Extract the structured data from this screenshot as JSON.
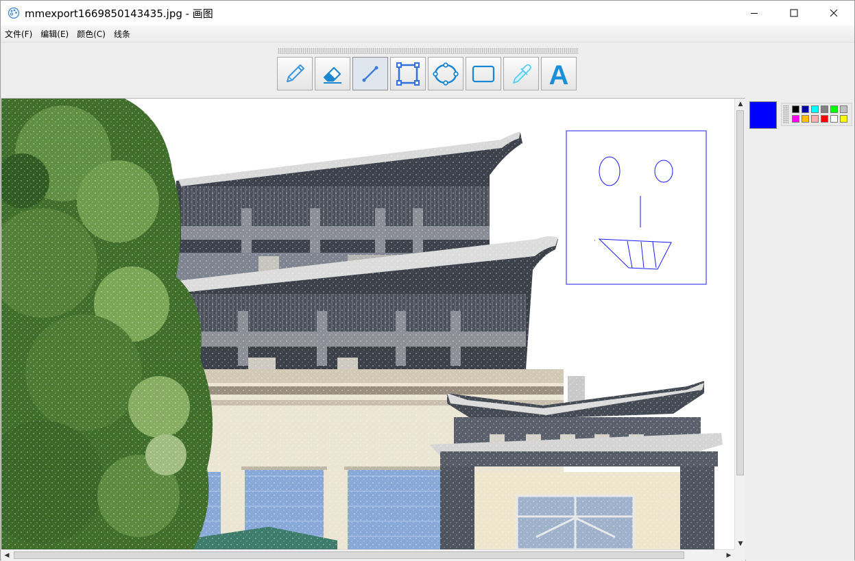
{
  "window": {
    "title": "mmexport1669850143435.jpg - 画图",
    "controls": {
      "minimize_icon": "minimize-icon",
      "maximize_icon": "maximize-icon",
      "close_icon": "close-icon"
    }
  },
  "menu": {
    "items": [
      {
        "label": "文件(F)"
      },
      {
        "label": "编辑(E)"
      },
      {
        "label": "颜色(C)"
      },
      {
        "label": "线条"
      }
    ]
  },
  "toolbar": {
    "tools": [
      {
        "icon": "pencil-icon",
        "selected": false
      },
      {
        "icon": "eraser-icon",
        "selected": false
      },
      {
        "icon": "line-icon",
        "selected": true
      },
      {
        "icon": "rectangle-select-icon",
        "selected": false
      },
      {
        "icon": "ellipse-icon",
        "selected": false
      },
      {
        "icon": "rounded-rectangle-icon",
        "selected": false
      },
      {
        "icon": "color-picker-icon",
        "selected": false
      },
      {
        "icon": "text-icon",
        "glyph": "A",
        "selected": false
      }
    ]
  },
  "canvas": {
    "image_file": "mmexport1669850143435.jpg",
    "drawing_color": "#1a1aff"
  },
  "colors": {
    "current": "#0000ff",
    "palette": [
      "#000000",
      "#0000a0",
      "#00ffff",
      "#808080",
      "#00ff00",
      "#c0c0c0",
      "#ff00ff",
      "#ffc000",
      "#ffafaf",
      "#ff0000",
      "#ffffff",
      "#ffff00"
    ]
  }
}
